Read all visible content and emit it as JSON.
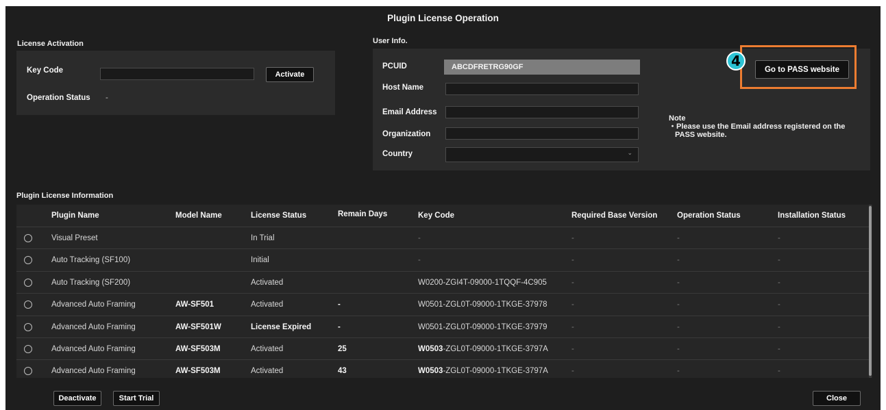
{
  "window": {
    "title": "Plugin License Operation"
  },
  "license_activation": {
    "section_label": "License Activation",
    "key_code_label": "Key Code",
    "key_code_value": "",
    "activate_label": "Activate",
    "operation_status_label": "Operation Status",
    "operation_status_value": "-"
  },
  "user_info": {
    "section_label": "User Info.",
    "pcuid_label": "PCUID",
    "pcuid_value": "ABCDFRETRG90GF",
    "host_name_label": "Host Name",
    "email_label": "Email Address",
    "organization_label": "Organization",
    "country_label": "Country",
    "country_value": "",
    "go_pass_label": "Go to PASS website",
    "note_title": "Note",
    "note_text": "・Please use the Email address registered on the",
    "note_text_2": "PASS website."
  },
  "callout": {
    "number": "4",
    "color": "#ed7d31",
    "badge_color": "#2cc3d4"
  },
  "plugin_info": {
    "section_label": "Plugin License Information",
    "columns": [
      "Plugin Name",
      "Model Name",
      "License Status",
      "Remain Days",
      "Key Code",
      "Required Base Version",
      "Operation Status",
      "Installation Status"
    ],
    "rows": [
      {
        "plugin": "Visual Preset",
        "model": "",
        "status": "In Trial",
        "remain": "",
        "key_prefix": "",
        "key_rest": "-",
        "base": "-",
        "op": "-",
        "inst": "-"
      },
      {
        "plugin": "Auto Tracking (SF100)",
        "model": "",
        "status": "Initial",
        "remain": "",
        "key_prefix": "",
        "key_rest": "-",
        "base": "-",
        "op": "-",
        "inst": "-"
      },
      {
        "plugin": "Auto Tracking (SF200)",
        "model": "",
        "status": "Activated",
        "remain": "",
        "key_prefix": "",
        "key_rest": "W0200-ZGI4T-09000-1TQQF-4C905",
        "base": "-",
        "op": "-",
        "inst": "-"
      },
      {
        "plugin": "Advanced Auto Framing",
        "model": "AW-SF501",
        "status": "Activated",
        "remain": "-",
        "key_prefix": "",
        "key_rest": "W0501-ZGL0T-09000-1TKGE-37978",
        "base": "-",
        "op": "-",
        "inst": "-"
      },
      {
        "plugin": "Advanced Auto Framing",
        "model": "AW-SF501W",
        "status": "License Expired",
        "remain": "-",
        "key_prefix": "",
        "key_rest": "W0501-ZGL0T-09000-1TKGE-37979",
        "base": "-",
        "op": "-",
        "inst": "-"
      },
      {
        "plugin": "Advanced Auto Framing",
        "model": "AW-SF503M",
        "status": "Activated",
        "remain": "25",
        "key_prefix": "W0503",
        "key_rest": "-ZGL0T-09000-1TKGE-3797A",
        "base": "-",
        "op": "-",
        "inst": "-"
      },
      {
        "plugin": "Advanced Auto Framing",
        "model": "AW-SF503M",
        "status": "Activated",
        "remain": "43",
        "key_prefix": "W0503",
        "key_rest": "-ZGL0T-09000-1TKGE-3797A",
        "base": "-",
        "op": "-",
        "inst": "-"
      }
    ]
  },
  "footer": {
    "deactivate_label": "Deactivate",
    "start_trial_label": "Start Trial",
    "close_label": "Close"
  }
}
